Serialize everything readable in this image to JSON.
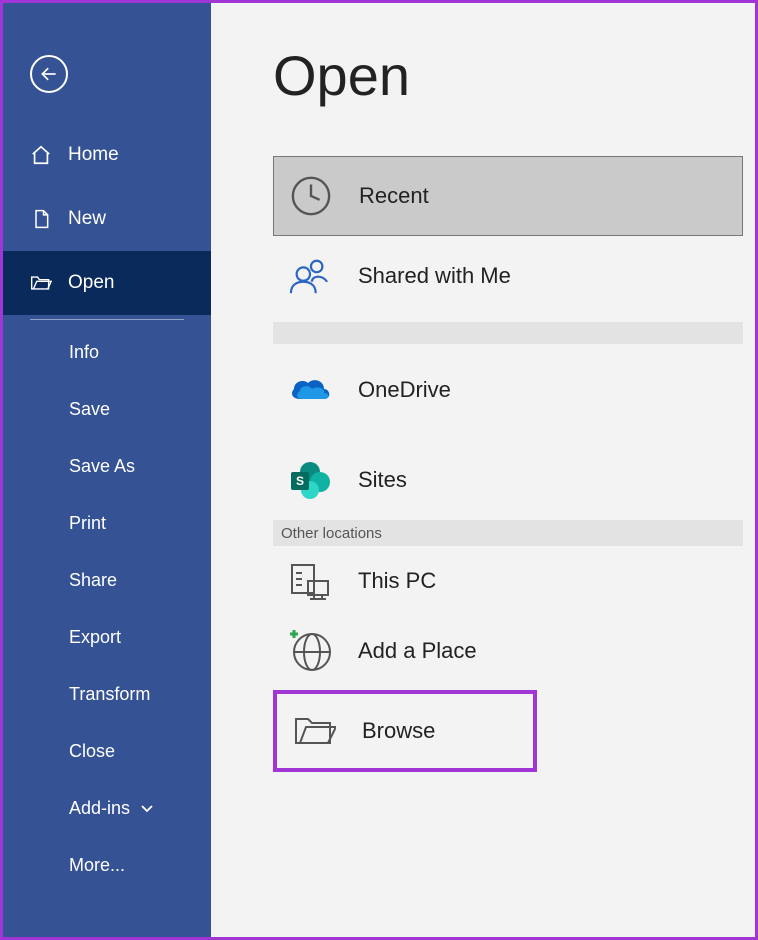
{
  "page_title": "Open",
  "sidebar": {
    "back_label": "Back",
    "primary": [
      {
        "id": "home",
        "label": "Home"
      },
      {
        "id": "new",
        "label": "New"
      },
      {
        "id": "open",
        "label": "Open",
        "selected": true
      }
    ],
    "secondary": [
      {
        "id": "info",
        "label": "Info"
      },
      {
        "id": "save",
        "label": "Save"
      },
      {
        "id": "saveas",
        "label": "Save As"
      },
      {
        "id": "print",
        "label": "Print"
      },
      {
        "id": "share",
        "label": "Share"
      },
      {
        "id": "export",
        "label": "Export"
      },
      {
        "id": "transform",
        "label": "Transform"
      },
      {
        "id": "close",
        "label": "Close"
      },
      {
        "id": "addins",
        "label": "Add-ins",
        "has_chevron": true
      },
      {
        "id": "more",
        "label": "More..."
      }
    ]
  },
  "locations": {
    "selected": "recent",
    "top": [
      {
        "id": "recent",
        "label": "Recent"
      },
      {
        "id": "shared",
        "label": "Shared with Me"
      }
    ],
    "cloud": [
      {
        "id": "onedrive",
        "label": "OneDrive"
      },
      {
        "id": "sites",
        "label": "Sites"
      }
    ],
    "other_header": "Other locations",
    "other": [
      {
        "id": "thispc",
        "label": "This PC"
      },
      {
        "id": "addplace",
        "label": "Add a Place"
      },
      {
        "id": "browse",
        "label": "Browse"
      }
    ]
  }
}
